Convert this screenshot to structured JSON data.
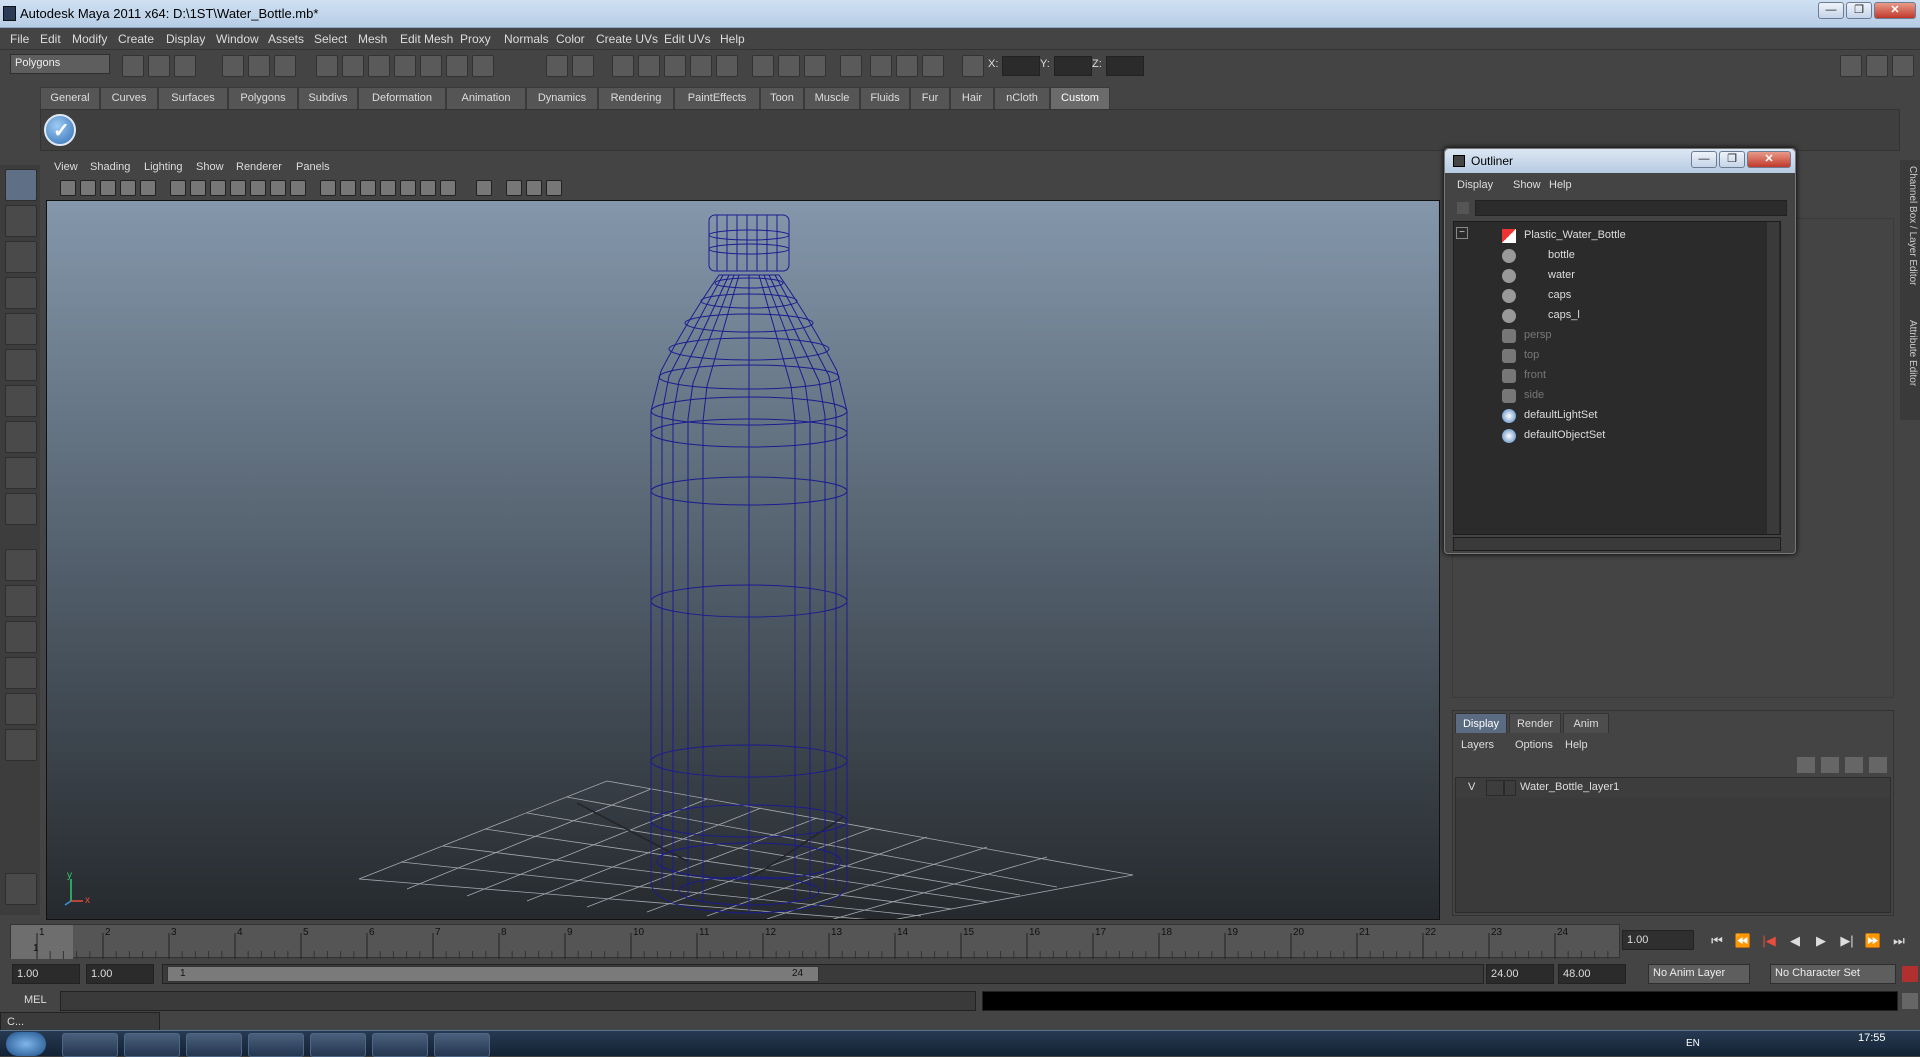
{
  "window": {
    "title": "Autodesk Maya 2011 x64: D:\\1ST\\Water_Bottle.mb*",
    "btn_min": "—",
    "btn_max": "❐",
    "btn_close": "✕"
  },
  "menubar": [
    "File",
    "Edit",
    "Modify",
    "Create",
    "Display",
    "Window",
    "Assets",
    "Select",
    "Mesh",
    "Edit Mesh",
    "Proxy",
    "Normals",
    "Color",
    "Create UVs",
    "Edit UVs",
    "Help"
  ],
  "toolbar": {
    "mode": "Polygons",
    "x_label": "X:",
    "y_label": "Y:",
    "z_label": "Z:"
  },
  "shelf": {
    "tabs": [
      "General",
      "Curves",
      "Surfaces",
      "Polygons",
      "Subdivs",
      "Deformation",
      "Animation",
      "Dynamics",
      "Rendering",
      "PaintEffects",
      "Toon",
      "Muscle",
      "Fluids",
      "Fur",
      "Hair",
      "nCloth",
      "Custom"
    ],
    "active": "Custom"
  },
  "panel": {
    "menus": [
      "View",
      "Shading",
      "Lighting",
      "Show",
      "Renderer",
      "Panels"
    ],
    "axis_y": "y",
    "axis_x": "x"
  },
  "outliner": {
    "title": "Outliner",
    "menus": [
      "Display",
      "Show",
      "Help"
    ],
    "items": [
      {
        "label": "Plastic_Water_Bottle",
        "dim": false,
        "indent": 0,
        "kind": "group"
      },
      {
        "label": "bottle",
        "dim": false,
        "indent": 1,
        "kind": "mesh"
      },
      {
        "label": "water",
        "dim": false,
        "indent": 1,
        "kind": "mesh"
      },
      {
        "label": "caps",
        "dim": false,
        "indent": 1,
        "kind": "mesh"
      },
      {
        "label": "caps_l",
        "dim": false,
        "indent": 1,
        "kind": "mesh"
      },
      {
        "label": "persp",
        "dim": true,
        "indent": 0,
        "kind": "camera"
      },
      {
        "label": "top",
        "dim": true,
        "indent": 0,
        "kind": "camera"
      },
      {
        "label": "front",
        "dim": true,
        "indent": 0,
        "kind": "camera"
      },
      {
        "label": "side",
        "dim": true,
        "indent": 0,
        "kind": "camera"
      },
      {
        "label": "defaultLightSet",
        "dim": false,
        "indent": 0,
        "kind": "set"
      },
      {
        "label": "defaultObjectSet",
        "dim": false,
        "indent": 0,
        "kind": "set"
      }
    ],
    "collapse_symbol": "−"
  },
  "side_tabs": [
    "Channel Box / Layer Editor",
    "Attribute Editor"
  ],
  "layers": {
    "tabs": [
      "Display",
      "Render",
      "Anim"
    ],
    "active": "Display",
    "menus": [
      "Layers",
      "Options",
      "Help"
    ],
    "rows": [
      {
        "visible": "V",
        "name": "Water_Bottle_layer1"
      }
    ]
  },
  "timeline": {
    "frames": [
      "1",
      "2",
      "3",
      "4",
      "5",
      "6",
      "7",
      "8",
      "9",
      "10",
      "11",
      "12",
      "13",
      "14",
      "15",
      "16",
      "17",
      "18",
      "19",
      "20",
      "21",
      "22",
      "23",
      "24"
    ],
    "current": "1",
    "current_field": "1.00"
  },
  "range": {
    "start": "1.00",
    "start2": "1.00",
    "slider_start": "1",
    "slider_end": "24",
    "end": "24.00",
    "end2": "48.00",
    "anim_layer": "No Anim Layer",
    "char_set": "No Character Set"
  },
  "cmd": {
    "label": "MEL"
  },
  "taskbar": {
    "time": "17:55",
    "lang": "EN"
  },
  "mini_window": {
    "label": "C..."
  }
}
